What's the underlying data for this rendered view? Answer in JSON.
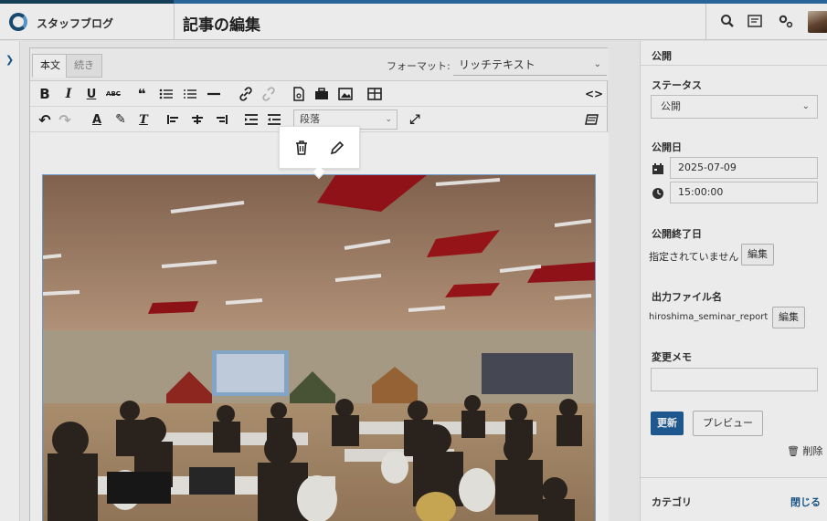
{
  "header": {
    "site_name": "スタッフブログ",
    "page_title": "記事の編集",
    "icons": [
      "search-icon",
      "list-icon",
      "settings-icon",
      "avatar"
    ]
  },
  "editor": {
    "tabs": [
      "本文",
      "続き"
    ],
    "format_label": "フォーマット:",
    "format_value": "リッチテキスト",
    "paragraph_value": "段落",
    "toolbar_row1": [
      "bold",
      "italic",
      "underline",
      "strikethrough",
      "blockquote",
      "bulleted-list",
      "numbered-list",
      "horizontal-rule",
      "link",
      "unlink",
      "insert-file",
      "insert-asset",
      "insert-image",
      "table",
      "source-code"
    ],
    "toolbar_row2": [
      "undo",
      "redo",
      "text-color",
      "highlight",
      "clear-formatting",
      "align-left",
      "align-center",
      "align-right",
      "indent",
      "outdent",
      "paragraph-format",
      "fullscreen",
      "spellcheck"
    ],
    "image_tooltip": [
      "trash-icon",
      "edit-icon"
    ]
  },
  "sidebar": {
    "publish_heading": "公開",
    "status_label": "ステータス",
    "status_value": "公開",
    "publish_date_label": "公開日",
    "publish_date": "2025-07-09",
    "publish_time": "15:00:00",
    "end_date_label": "公開終了日",
    "end_date_value": "指定されていません",
    "edit_label": "編集",
    "output_file_label": "出力ファイル名",
    "output_file_value": "hiroshima_seminar_report",
    "change_memo_label": "変更メモ",
    "update_button": "更新",
    "preview_button": "プレビュー",
    "delete_label": "削除",
    "category_label": "カテゴリ",
    "category_close": "閉じる"
  },
  "colors": {
    "accent": "#2c6da5",
    "primary_button": "#1f5f99",
    "link": "#1d5d92"
  }
}
